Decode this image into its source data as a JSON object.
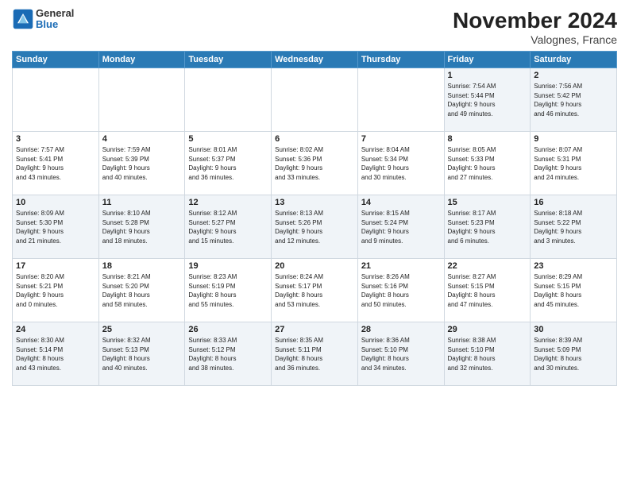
{
  "logo": {
    "general": "General",
    "blue": "Blue"
  },
  "title": "November 2024",
  "location": "Valognes, France",
  "days_of_week": [
    "Sunday",
    "Monday",
    "Tuesday",
    "Wednesday",
    "Thursday",
    "Friday",
    "Saturday"
  ],
  "weeks": [
    [
      {
        "day": null,
        "info": null
      },
      {
        "day": null,
        "info": null
      },
      {
        "day": null,
        "info": null
      },
      {
        "day": null,
        "info": null
      },
      {
        "day": null,
        "info": null
      },
      {
        "day": "1",
        "info": "Sunrise: 7:54 AM\nSunset: 5:44 PM\nDaylight: 9 hours\nand 49 minutes."
      },
      {
        "day": "2",
        "info": "Sunrise: 7:56 AM\nSunset: 5:42 PM\nDaylight: 9 hours\nand 46 minutes."
      }
    ],
    [
      {
        "day": "3",
        "info": "Sunrise: 7:57 AM\nSunset: 5:41 PM\nDaylight: 9 hours\nand 43 minutes."
      },
      {
        "day": "4",
        "info": "Sunrise: 7:59 AM\nSunset: 5:39 PM\nDaylight: 9 hours\nand 40 minutes."
      },
      {
        "day": "5",
        "info": "Sunrise: 8:01 AM\nSunset: 5:37 PM\nDaylight: 9 hours\nand 36 minutes."
      },
      {
        "day": "6",
        "info": "Sunrise: 8:02 AM\nSunset: 5:36 PM\nDaylight: 9 hours\nand 33 minutes."
      },
      {
        "day": "7",
        "info": "Sunrise: 8:04 AM\nSunset: 5:34 PM\nDaylight: 9 hours\nand 30 minutes."
      },
      {
        "day": "8",
        "info": "Sunrise: 8:05 AM\nSunset: 5:33 PM\nDaylight: 9 hours\nand 27 minutes."
      },
      {
        "day": "9",
        "info": "Sunrise: 8:07 AM\nSunset: 5:31 PM\nDaylight: 9 hours\nand 24 minutes."
      }
    ],
    [
      {
        "day": "10",
        "info": "Sunrise: 8:09 AM\nSunset: 5:30 PM\nDaylight: 9 hours\nand 21 minutes."
      },
      {
        "day": "11",
        "info": "Sunrise: 8:10 AM\nSunset: 5:28 PM\nDaylight: 9 hours\nand 18 minutes."
      },
      {
        "day": "12",
        "info": "Sunrise: 8:12 AM\nSunset: 5:27 PM\nDaylight: 9 hours\nand 15 minutes."
      },
      {
        "day": "13",
        "info": "Sunrise: 8:13 AM\nSunset: 5:26 PM\nDaylight: 9 hours\nand 12 minutes."
      },
      {
        "day": "14",
        "info": "Sunrise: 8:15 AM\nSunset: 5:24 PM\nDaylight: 9 hours\nand 9 minutes."
      },
      {
        "day": "15",
        "info": "Sunrise: 8:17 AM\nSunset: 5:23 PM\nDaylight: 9 hours\nand 6 minutes."
      },
      {
        "day": "16",
        "info": "Sunrise: 8:18 AM\nSunset: 5:22 PM\nDaylight: 9 hours\nand 3 minutes."
      }
    ],
    [
      {
        "day": "17",
        "info": "Sunrise: 8:20 AM\nSunset: 5:21 PM\nDaylight: 9 hours\nand 0 minutes."
      },
      {
        "day": "18",
        "info": "Sunrise: 8:21 AM\nSunset: 5:20 PM\nDaylight: 8 hours\nand 58 minutes."
      },
      {
        "day": "19",
        "info": "Sunrise: 8:23 AM\nSunset: 5:19 PM\nDaylight: 8 hours\nand 55 minutes."
      },
      {
        "day": "20",
        "info": "Sunrise: 8:24 AM\nSunset: 5:17 PM\nDaylight: 8 hours\nand 53 minutes."
      },
      {
        "day": "21",
        "info": "Sunrise: 8:26 AM\nSunset: 5:16 PM\nDaylight: 8 hours\nand 50 minutes."
      },
      {
        "day": "22",
        "info": "Sunrise: 8:27 AM\nSunset: 5:15 PM\nDaylight: 8 hours\nand 47 minutes."
      },
      {
        "day": "23",
        "info": "Sunrise: 8:29 AM\nSunset: 5:15 PM\nDaylight: 8 hours\nand 45 minutes."
      }
    ],
    [
      {
        "day": "24",
        "info": "Sunrise: 8:30 AM\nSunset: 5:14 PM\nDaylight: 8 hours\nand 43 minutes."
      },
      {
        "day": "25",
        "info": "Sunrise: 8:32 AM\nSunset: 5:13 PM\nDaylight: 8 hours\nand 40 minutes."
      },
      {
        "day": "26",
        "info": "Sunrise: 8:33 AM\nSunset: 5:12 PM\nDaylight: 8 hours\nand 38 minutes."
      },
      {
        "day": "27",
        "info": "Sunrise: 8:35 AM\nSunset: 5:11 PM\nDaylight: 8 hours\nand 36 minutes."
      },
      {
        "day": "28",
        "info": "Sunrise: 8:36 AM\nSunset: 5:10 PM\nDaylight: 8 hours\nand 34 minutes."
      },
      {
        "day": "29",
        "info": "Sunrise: 8:38 AM\nSunset: 5:10 PM\nDaylight: 8 hours\nand 32 minutes."
      },
      {
        "day": "30",
        "info": "Sunrise: 8:39 AM\nSunset: 5:09 PM\nDaylight: 8 hours\nand 30 minutes."
      }
    ]
  ]
}
